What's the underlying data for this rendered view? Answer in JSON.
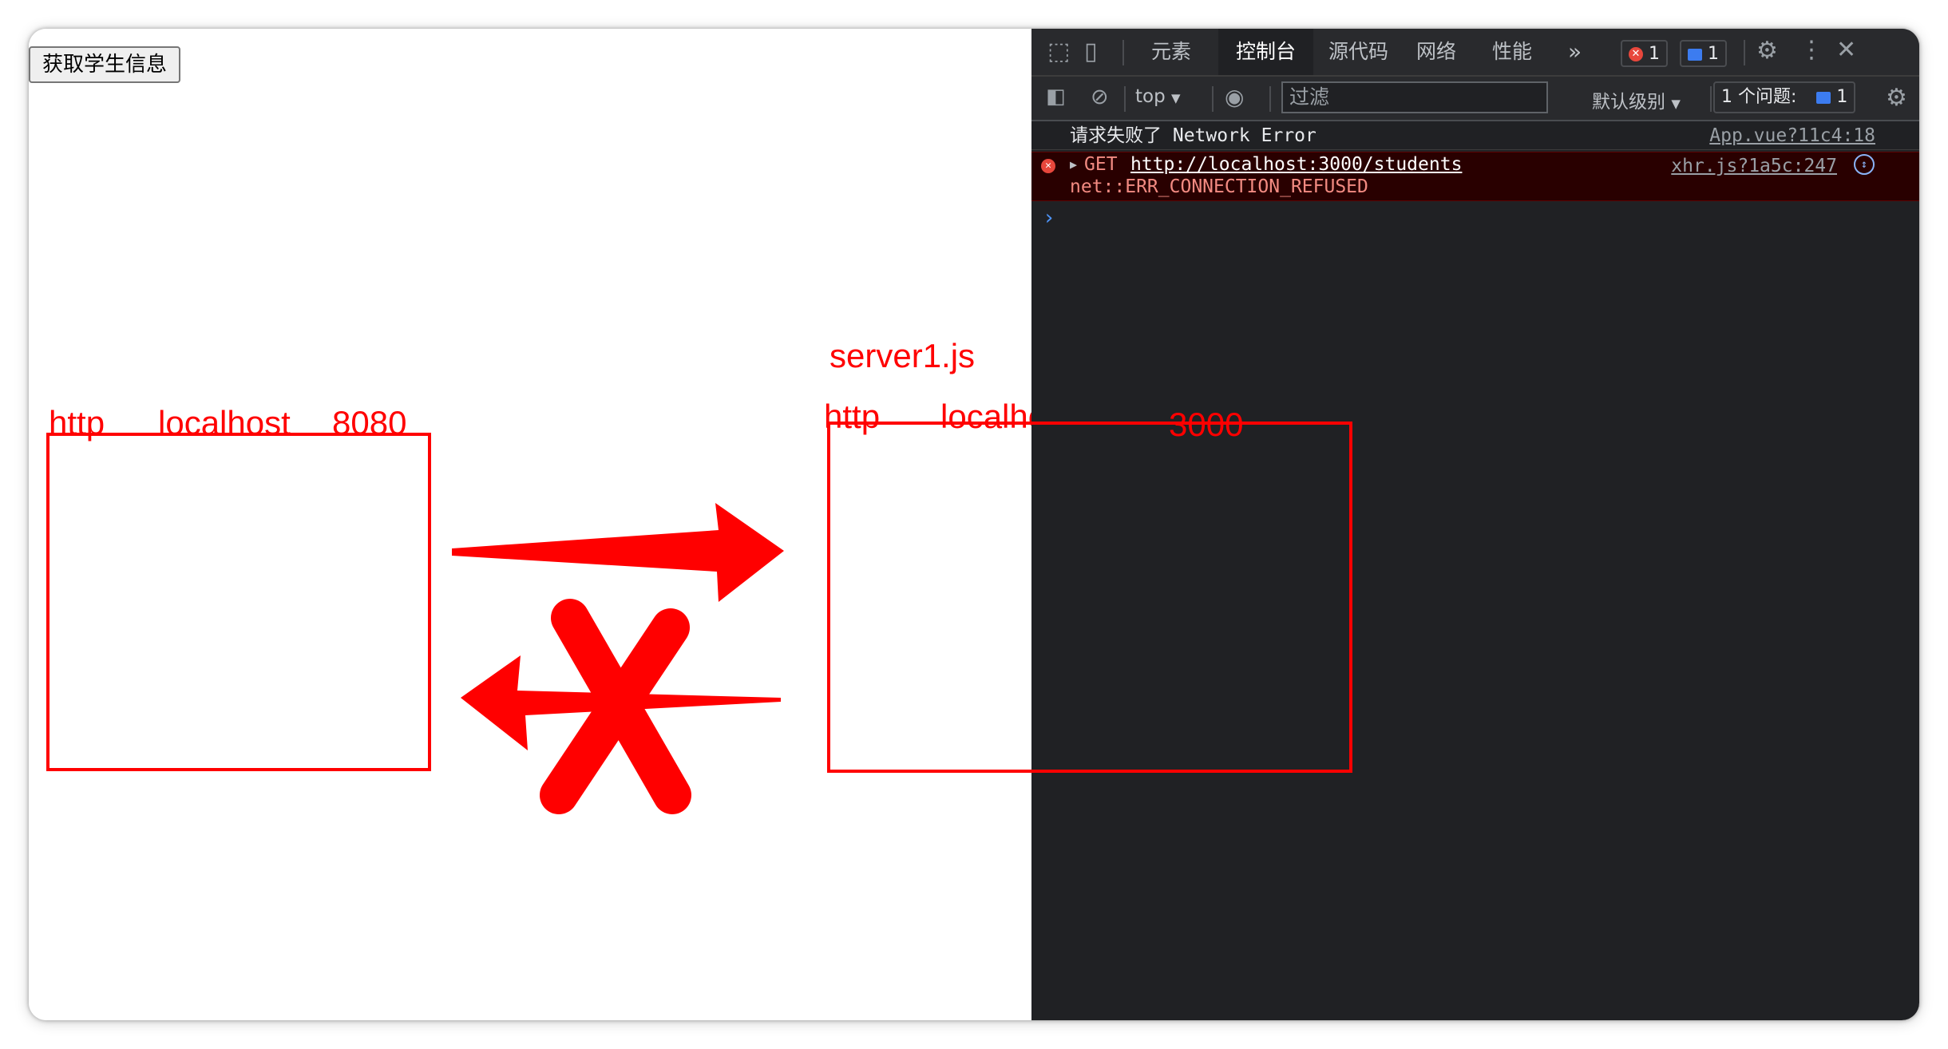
{
  "page": {
    "button_label": "获取学生信息",
    "left_box": {
      "protocol": "http",
      "host": "localhost",
      "port": "8080"
    },
    "right_box": {
      "title": "server1.js",
      "protocol": "http",
      "host": "localhost",
      "port": "3000"
    }
  },
  "devtools": {
    "tabs": [
      "元素",
      "控制台",
      "源代码",
      "网络",
      "性能"
    ],
    "active_tab": "控制台",
    "more_tabs_glyph": "»",
    "error_count": "1",
    "message_count": "1",
    "context_label": "top",
    "filter_placeholder": "过滤",
    "level_label": "默认级别",
    "issues_label": "1 个问题:",
    "issues_count": "1",
    "console": {
      "log_message": "请求失败了 Network Error",
      "log_source": "App.vue?11c4:18",
      "error_method": "GET",
      "error_url": "http://localhost:3000/students",
      "error_detail": "net::ERR_CONNECTION_REFUSED",
      "error_source": "xhr.js?1a5c:247",
      "prompt_glyph": "›"
    },
    "colors": {
      "panel_bg": "#202124",
      "toolbar_bg": "#292a2d",
      "error_text": "#f28b82",
      "error_bg": "#290000",
      "accent": "#ff0000"
    }
  }
}
